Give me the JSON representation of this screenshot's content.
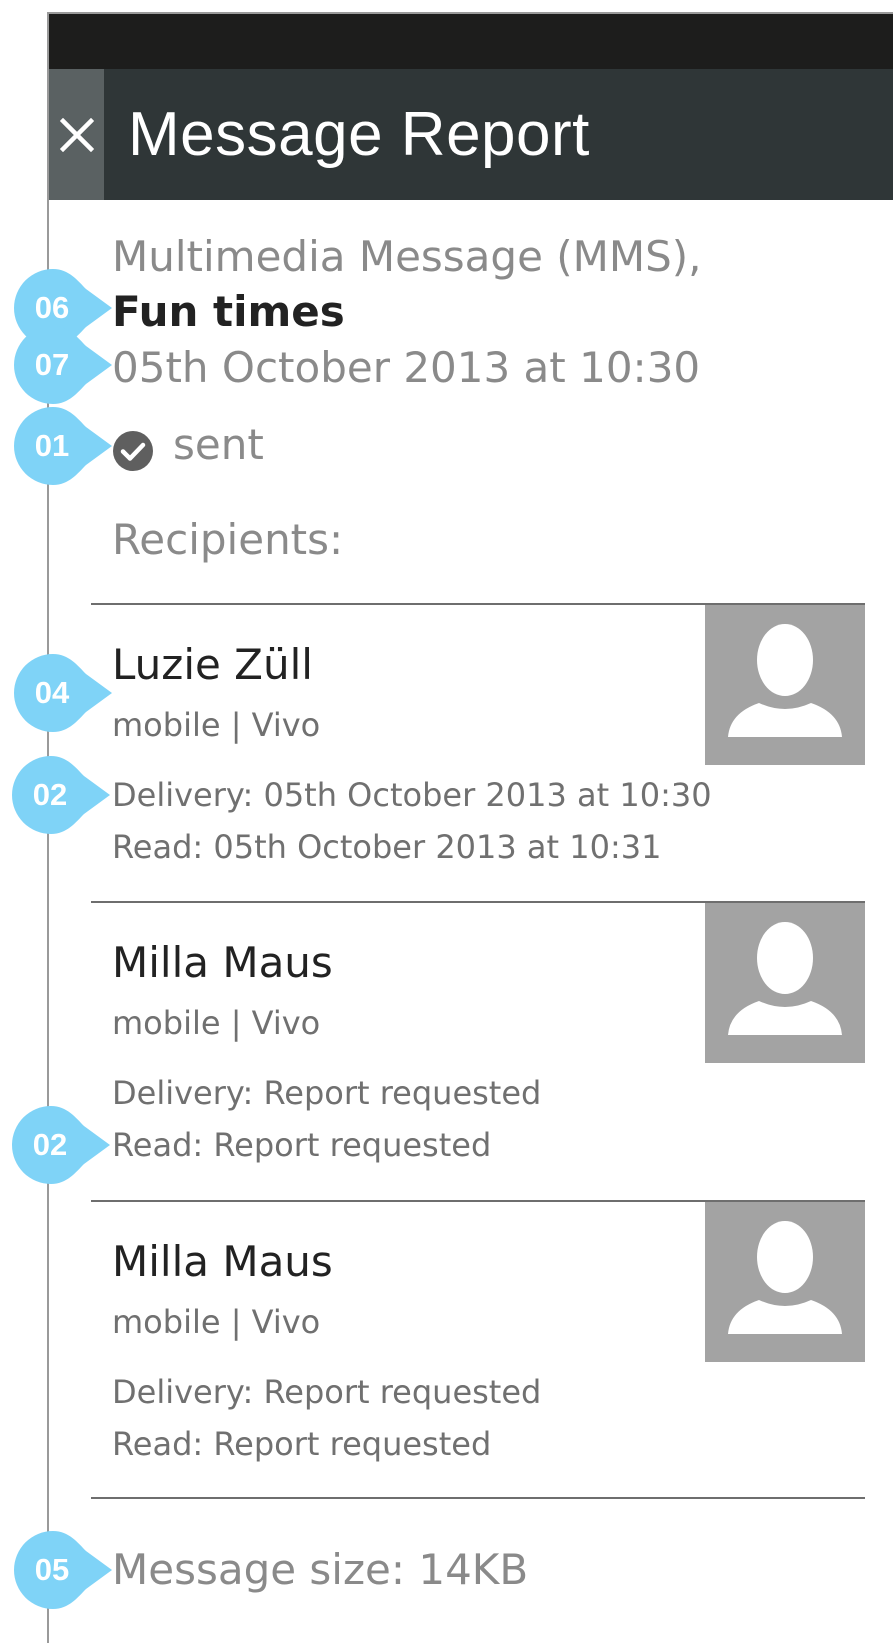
{
  "header": {
    "title": "Message Report",
    "close_icon": "close-icon"
  },
  "message": {
    "type": "Multimedia Message (MMS),",
    "subject": "Fun times",
    "date": "05th October 2013 at 10:30",
    "status": "sent",
    "status_icon": "check-circle-icon",
    "recipients_label": "Recipients:",
    "size": "Message size: 14KB"
  },
  "recipients": [
    {
      "name": "Luzie Züll",
      "info": "mobile | Vivo",
      "delivery": "Delivery: 05th October 2013 at 10:30",
      "read": "Read: 05th October 2013 at 10:31",
      "avatar_icon": "person-icon"
    },
    {
      "name": "Milla Maus",
      "info": "mobile | Vivo",
      "delivery": "Delivery: Report requested",
      "read": "Read: Report requested",
      "avatar_icon": "person-icon"
    },
    {
      "name": "Milla Maus",
      "info": "mobile | Vivo",
      "delivery": "Delivery: Report requested",
      "read": "Read: Report requested",
      "avatar_icon": "person-icon"
    }
  ],
  "annotations": [
    "06",
    "07",
    "01",
    "04",
    "02",
    "02",
    "05"
  ],
  "colors": {
    "header_bg": "#2f3637",
    "statusbar_bg": "#1d1d1c",
    "annotation": "#7fd3f7",
    "avatar_bg": "#a3a3a3"
  }
}
